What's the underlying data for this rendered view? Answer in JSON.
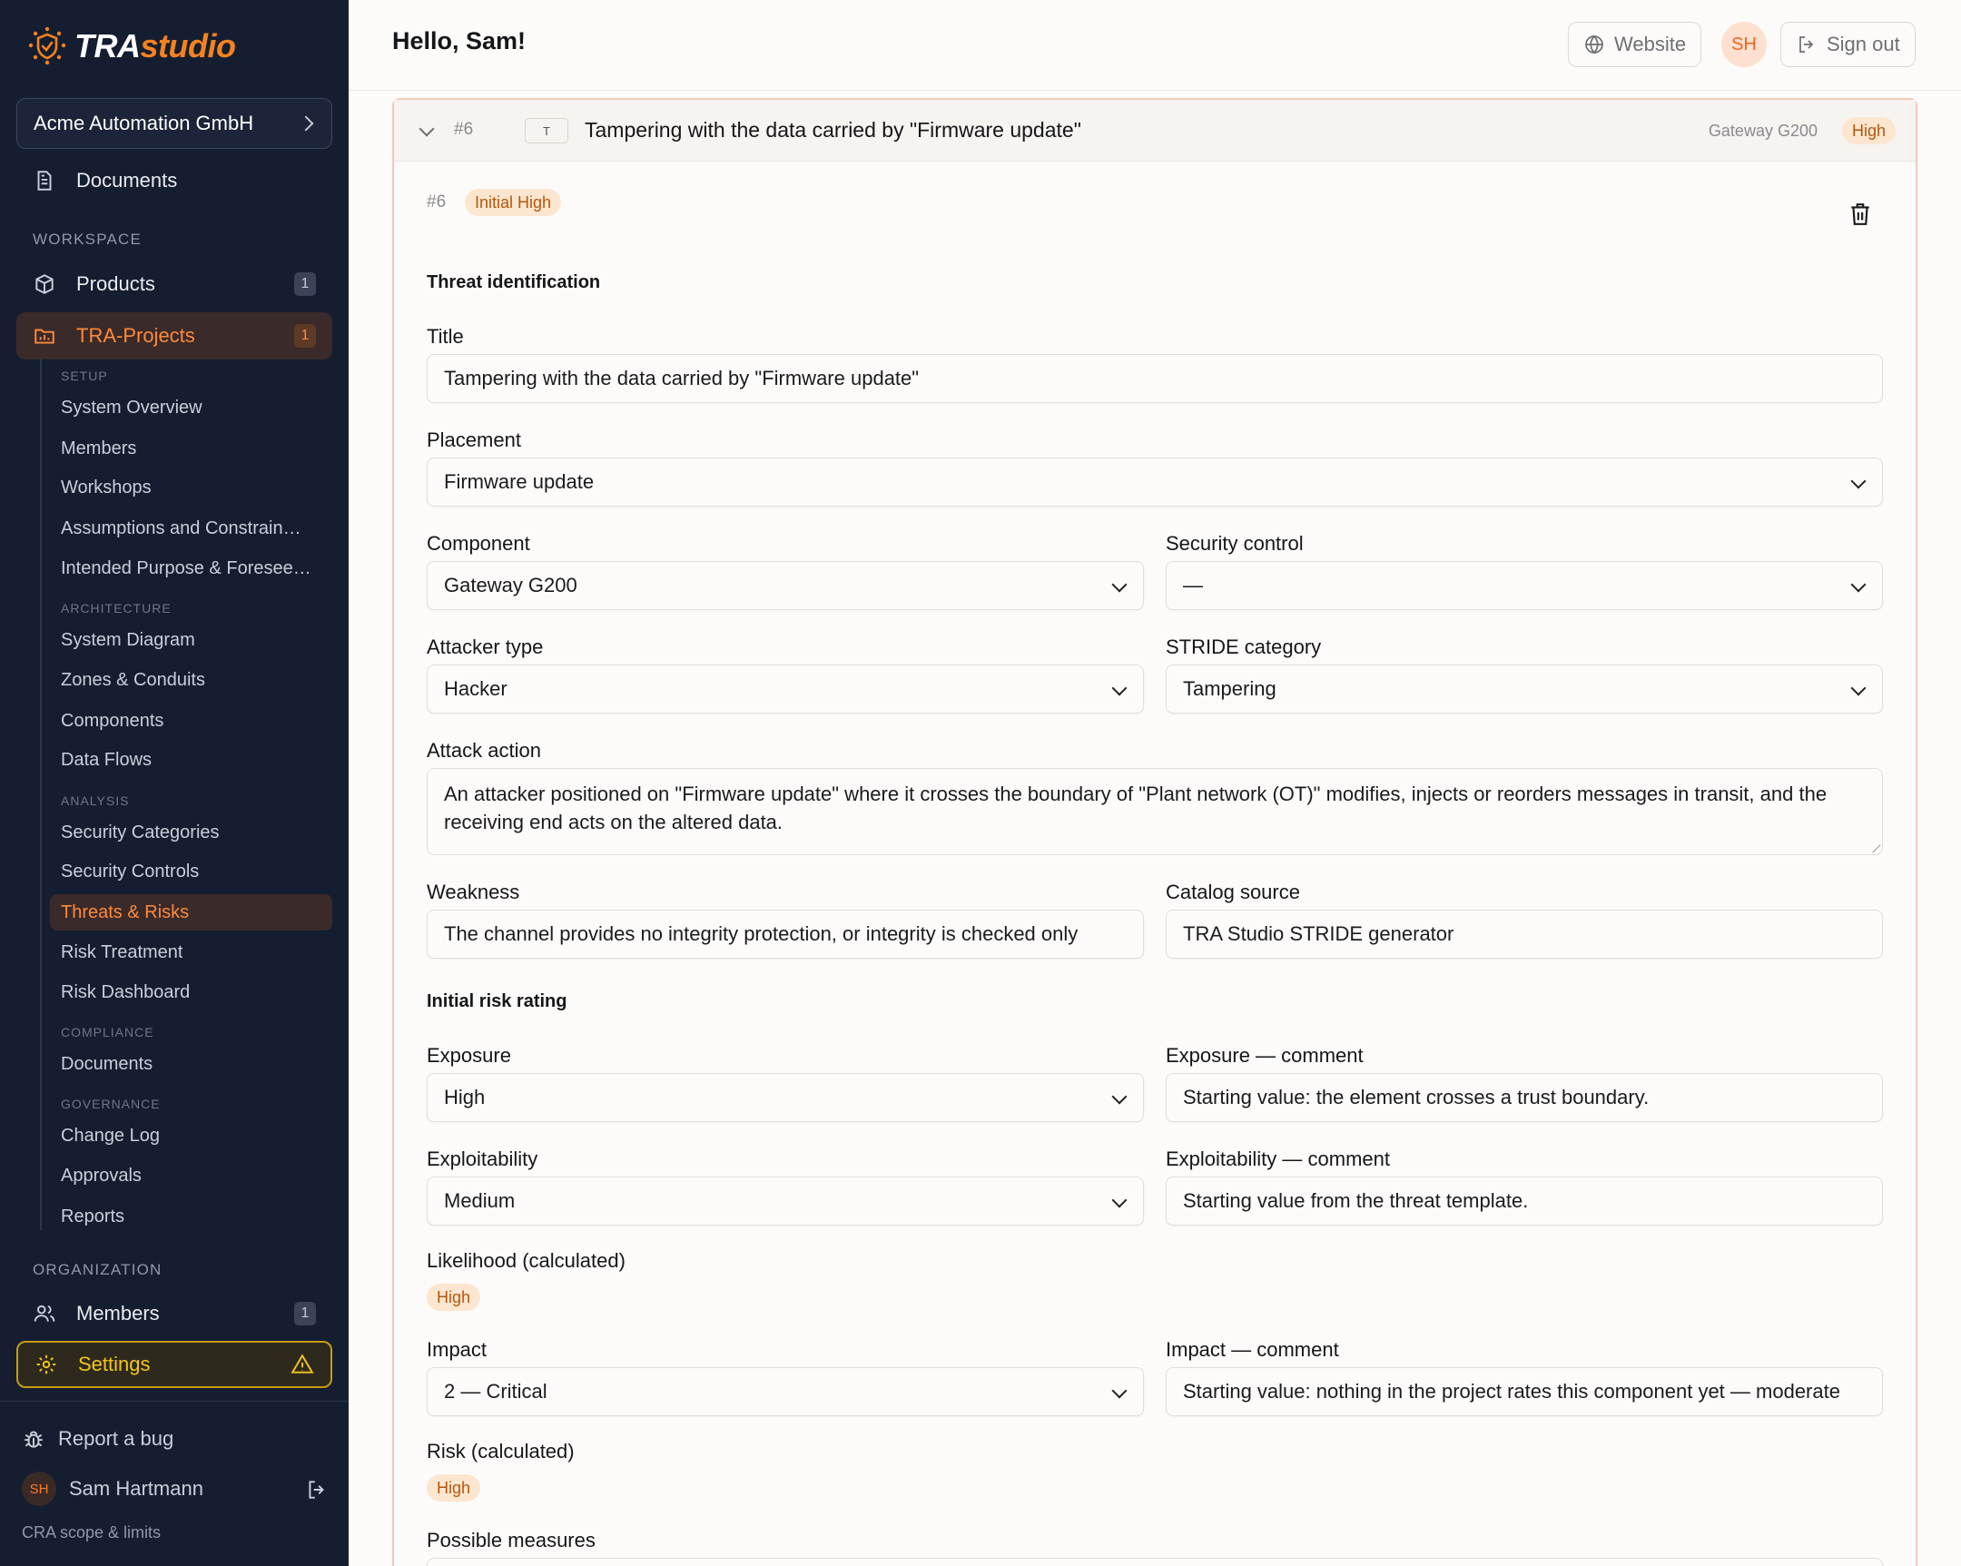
{
  "brand": {
    "part1": "TRA",
    "part2": "studio"
  },
  "org": {
    "name": "Acme Automation GmbH"
  },
  "nav": {
    "documents": "Documents",
    "workspace_label": "WORKSPACE",
    "products": {
      "label": "Products",
      "count": "1"
    },
    "tra_projects": {
      "label": "TRA-Projects",
      "count": "1"
    },
    "setup_label": "SETUP",
    "setup": [
      "System Overview",
      "Members",
      "Workshops",
      "Assumptions and Constrain…",
      "Intended Purpose & Foresee…"
    ],
    "architecture_label": "ARCHITECTURE",
    "architecture": [
      "System Diagram",
      "Zones & Conduits",
      "Components",
      "Data Flows"
    ],
    "analysis_label": "ANALYSIS",
    "analysis": [
      "Security Categories",
      "Security Controls",
      "Threats & Risks",
      "Risk Treatment",
      "Risk Dashboard"
    ],
    "compliance_label": "COMPLIANCE",
    "compliance": [
      "Documents"
    ],
    "governance_label": "GOVERNANCE",
    "governance": [
      "Change Log",
      "Approvals",
      "Reports"
    ],
    "organization_label": "ORGANIZATION",
    "members": {
      "label": "Members",
      "count": "1"
    },
    "settings": "Settings"
  },
  "sidebar_footer": {
    "report_bug": "Report a bug",
    "user_initials": "SH",
    "user_name": "Sam Hartmann",
    "scope_link": "CRA scope & limits"
  },
  "header": {
    "greeting": "Hello, Sam!",
    "website": "Website",
    "avatar": "SH",
    "sign_out": "Sign out"
  },
  "threat": {
    "number": "#6",
    "stride_letter": "T",
    "title": "Tampering with the data carried by \"Firmware update\"",
    "component": "Gateway G200",
    "level": "High",
    "initial_badge": "Initial High"
  },
  "form": {
    "section_identification": "Threat identification",
    "title_label": "Title",
    "title_value": "Tampering with the data carried by \"Firmware update\"",
    "placement_label": "Placement",
    "placement_value": "Firmware update",
    "component_label": "Component",
    "component_value": "Gateway G200",
    "security_control_label": "Security control",
    "security_control_value": "—",
    "attacker_label": "Attacker type",
    "attacker_value": "Hacker",
    "stride_label": "STRIDE category",
    "stride_value": "Tampering",
    "attack_action_label": "Attack action",
    "attack_action_value": "An attacker positioned on \"Firmware update\" where it crosses the boundary of \"Plant network (OT)\" modifies, injects or reorders messages in transit, and the receiving end acts on the altered data.",
    "weakness_label": "Weakness",
    "weakness_value": "The channel provides no integrity protection, or integrity is checked only",
    "catalog_label": "Catalog source",
    "catalog_value": "TRA Studio STRIDE generator",
    "section_rating": "Initial risk rating",
    "exposure_label": "Exposure",
    "exposure_value": "High",
    "exposure_comment_label": "Exposure — comment",
    "exposure_comment_value": "Starting value: the element crosses a trust boundary.",
    "exploitability_label": "Exploitability",
    "exploitability_value": "Medium",
    "exploitability_comment_label": "Exploitability — comment",
    "exploitability_comment_value": "Starting value from the threat template.",
    "likelihood_label": "Likelihood (calculated)",
    "likelihood_value": "High",
    "impact_label": "Impact",
    "impact_value": "2 — Critical",
    "impact_comment_label": "Impact — comment",
    "impact_comment_value": "Starting value: nothing in the project rates this component yet — moderate",
    "risk_label": "Risk (calculated)",
    "risk_value": "High",
    "measures_label": "Possible measures"
  },
  "colors": {
    "sidebar_bg": "#151e30",
    "accent": "#f58220",
    "badge_bg": "#fde6cf",
    "badge_text": "#b4560c"
  }
}
